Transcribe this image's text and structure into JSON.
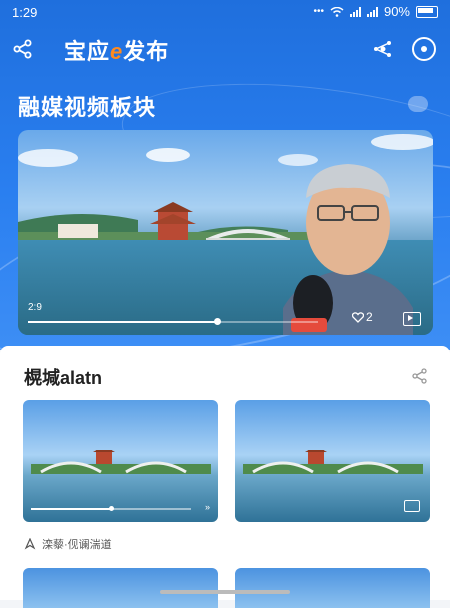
{
  "status_bar": {
    "time": "1:29",
    "battery": "90%"
  },
  "header": {
    "title_prefix": "宝应",
    "title_e": "e",
    "title_suffix": "发布"
  },
  "section": {
    "title": "融媒视频板块"
  },
  "main_video": {
    "current_time": "2:9",
    "progress_fraction": 0.65,
    "like_count": "2"
  },
  "card": {
    "title": "榥堿alatn",
    "caption": "滦藜·伣谰湍道",
    "left_thumb_progress_fraction": 0.5,
    "left_thumb_next": "»"
  },
  "colors": {
    "brand_blue": "#2a7ff0",
    "brand_orange": "#ff8a1e"
  }
}
